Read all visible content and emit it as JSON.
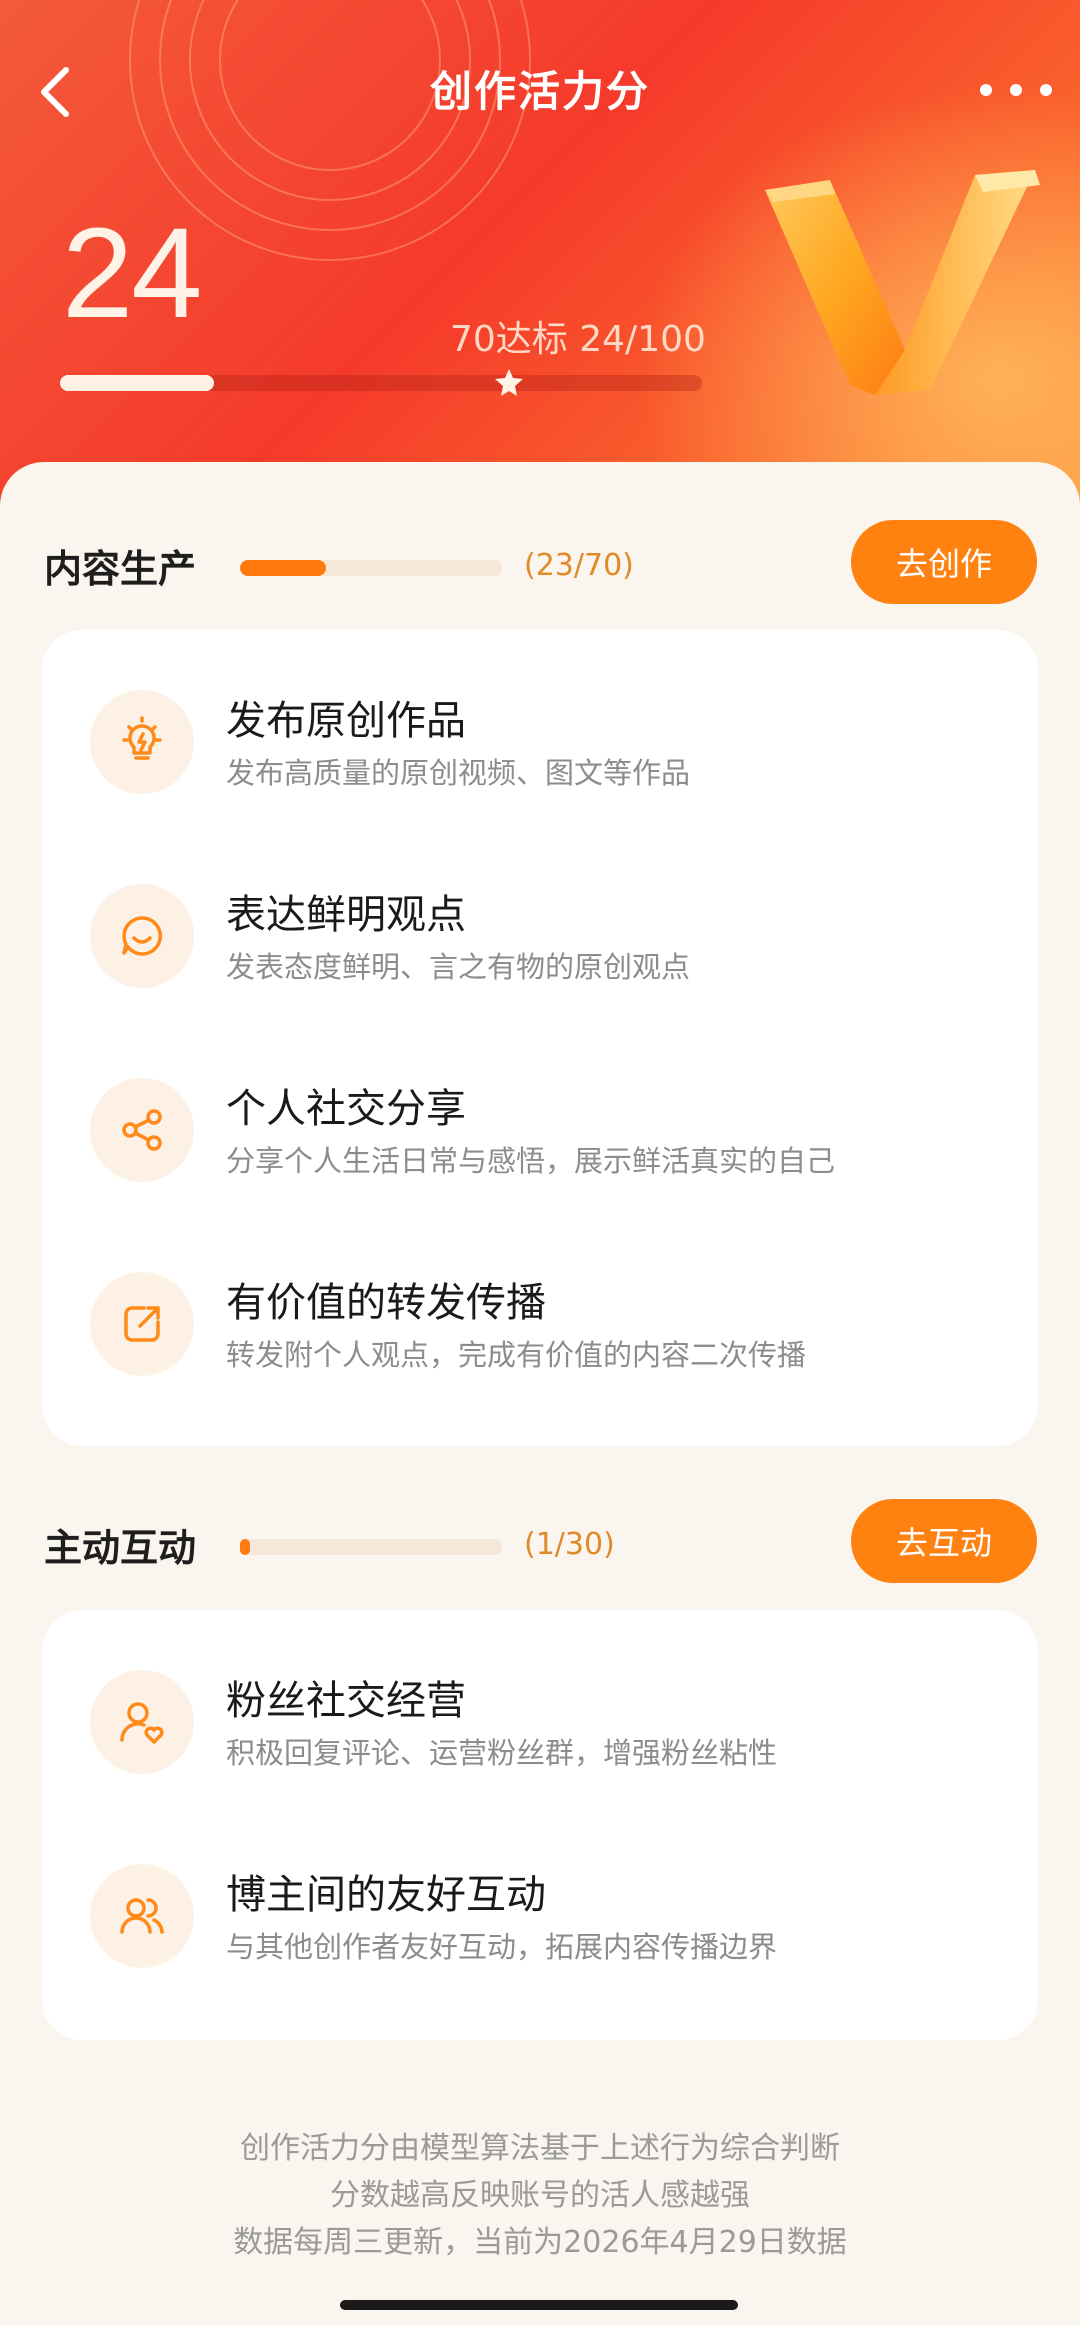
{
  "header": {
    "title": "创作活力分",
    "score": "24",
    "target_text": "70达标  24/100",
    "score_progress": 0.24,
    "threshold": 0.7
  },
  "sections": [
    {
      "title": "内容生产",
      "count": "(23/70)",
      "progress": 0.329,
      "button": "去创作",
      "items": [
        {
          "icon": "lightbulb-icon",
          "title": "发布原创作品",
          "desc": "发布高质量的原创视频、图文等作品"
        },
        {
          "icon": "chat-smile-icon",
          "title": "表达鲜明观点",
          "desc": "发表态度鲜明、言之有物的原创观点"
        },
        {
          "icon": "share-icon",
          "title": "个人社交分享",
          "desc": "分享个人生活日常与感悟，展示鲜活真实的自己"
        },
        {
          "icon": "forward-icon",
          "title": "有价值的转发传播",
          "desc": "转发附个人观点，完成有价值的内容二次传播"
        }
      ]
    },
    {
      "title": "主动互动",
      "count": "(1/30)",
      "progress": 0.033,
      "button": "去互动",
      "items": [
        {
          "icon": "fan-heart-icon",
          "title": "粉丝社交经营",
          "desc": "积极回复评论、运营粉丝群，增强粉丝粘性"
        },
        {
          "icon": "users-icon",
          "title": "博主间的友好互动",
          "desc": "与其他创作者友好互动，拓展内容传播边界"
        }
      ]
    }
  ],
  "footer": {
    "line1": "创作活力分由模型算法基于上述行为综合判断",
    "line2": "分数越高反映账号的活人感越强",
    "line3": "数据每周三更新，当前为2026年4月29日数据"
  },
  "colors": {
    "accent": "#ff8210",
    "header_red": "#f53a2b"
  }
}
